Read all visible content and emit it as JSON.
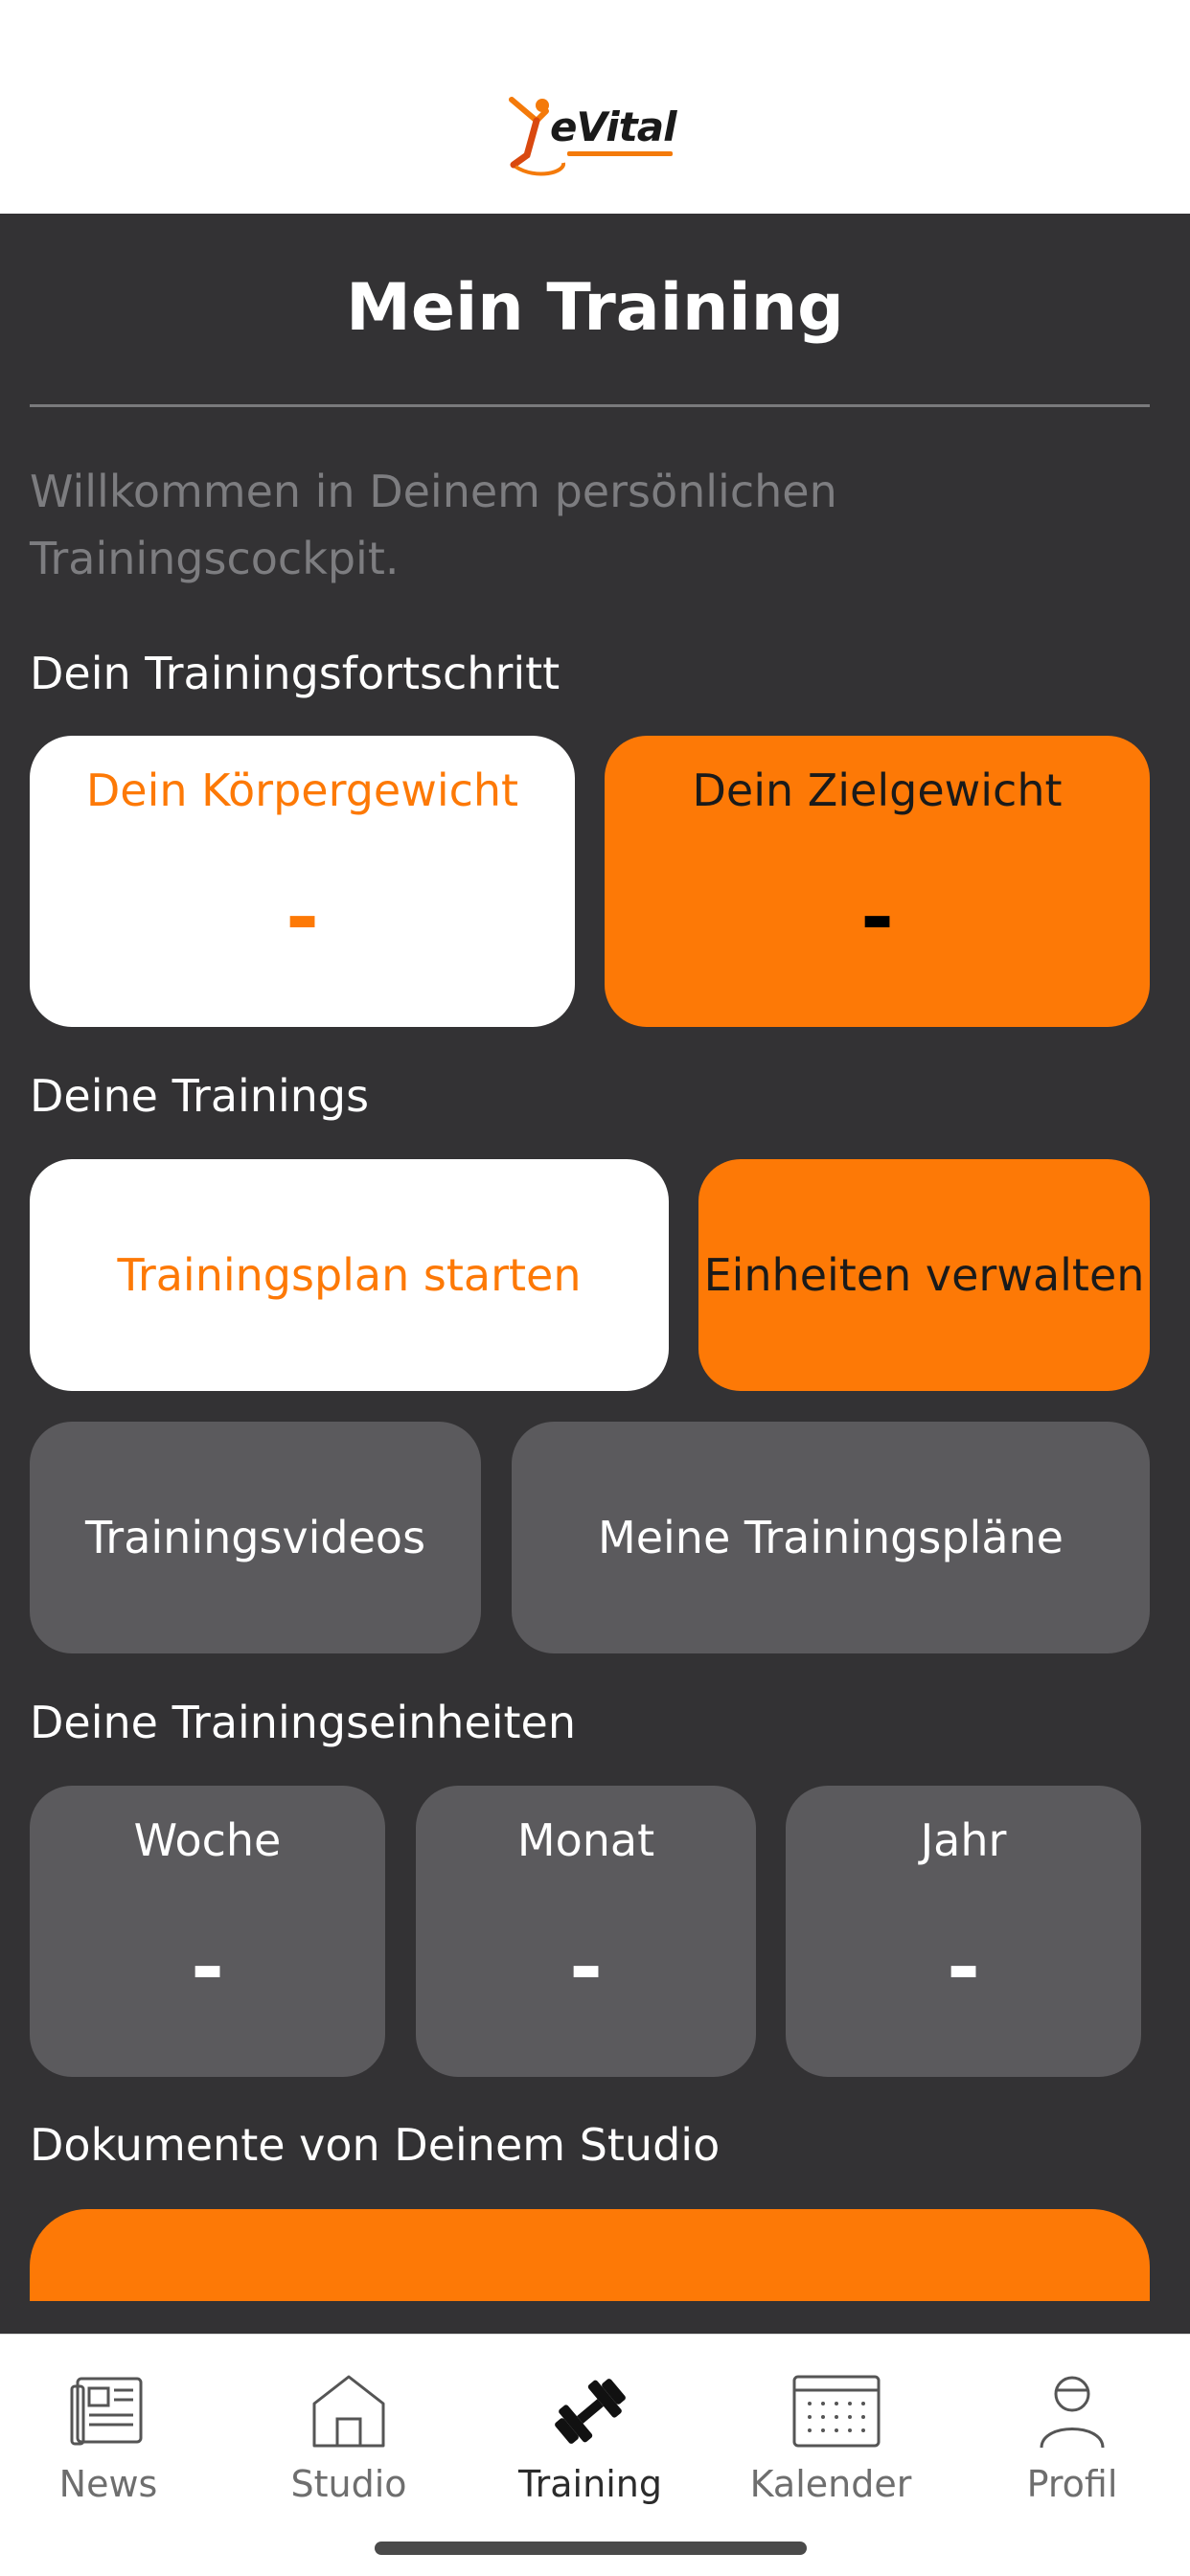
{
  "header": {
    "logo_text": "eVital",
    "colors": {
      "accent": "#fd7906",
      "background": "#333234",
      "card_gray": "#5b5a5d"
    }
  },
  "page": {
    "title": "Mein Training",
    "welcome": "Willkommen in Deinem persönlichen Trainingscockpit."
  },
  "progress": {
    "heading": "Dein Trainingsfortschritt",
    "body_weight": {
      "label": "Dein Körpergewicht",
      "value": "-"
    },
    "target_weight": {
      "label": "Dein Zielgewicht",
      "value": "-"
    }
  },
  "trainings": {
    "heading": "Deine Trainings",
    "start_plan": "Trainingsplan starten",
    "manage_units": "Einheiten verwalten",
    "videos": "Trainingsvideos",
    "my_plans": "Meine Trainingspläne"
  },
  "units": {
    "heading": "Deine Trainingseinheiten",
    "week": {
      "label": "Woche",
      "value": "-"
    },
    "month": {
      "label": "Monat",
      "value": "-"
    },
    "year": {
      "label": "Jahr",
      "value": "-"
    }
  },
  "documents": {
    "heading": "Dokumente von Deinem Studio"
  },
  "tabbar": {
    "items": [
      {
        "label": "News",
        "icon": "newspaper-icon"
      },
      {
        "label": "Studio",
        "icon": "house-icon"
      },
      {
        "label": "Training",
        "icon": "dumbbell-icon",
        "active": true
      },
      {
        "label": "Kalender",
        "icon": "calendar-icon"
      },
      {
        "label": "Profil",
        "icon": "person-icon"
      }
    ]
  }
}
